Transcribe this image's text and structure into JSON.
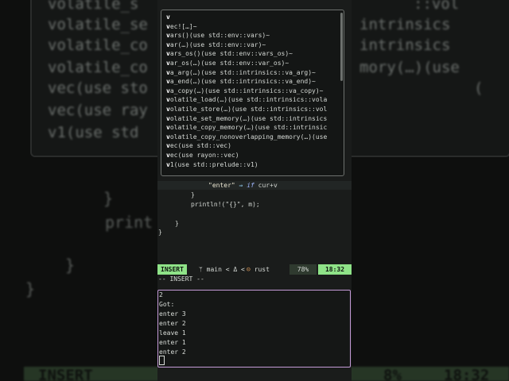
{
  "editor": {
    "code": {
      "match_arm": {
        "str": "\"enter\"",
        "arrow": "⇒",
        "kw": "if",
        "rest": "cur+v"
      },
      "close_brace_inner": "}",
      "println": "println!(\"{}\", m);",
      "close_brace_mid": "}",
      "close_brace_outer": "}"
    },
    "completion": {
      "items": [
        {
          "match": "v",
          "rest": ""
        },
        {
          "match": "v",
          "rest": "ec![…]~"
        },
        {
          "match": "v",
          "rest": "ars()(use std::env::vars)~"
        },
        {
          "match": "v",
          "rest": "ar(…)(use std::env::var)~"
        },
        {
          "match": "v",
          "rest": "ars_os()(use std::env::vars_os)~"
        },
        {
          "match": "v",
          "rest": "ar_os(…)(use std::env::var_os)~"
        },
        {
          "match": "v",
          "rest": "a_arg(…)(use std::intrinsics::va_arg)~"
        },
        {
          "match": "v",
          "rest": "a_end(…)(use std::intrinsics::va_end)~"
        },
        {
          "match": "v",
          "rest": "a_copy(…)(use std::intrinsics::va_copy)~"
        },
        {
          "match": "v",
          "rest": "olatile_load(…)(use std::intrinsics::vola"
        },
        {
          "match": "v",
          "rest": "olatile_store(…)(use std::intrinsics::vol"
        },
        {
          "match": "v",
          "rest": "olatile_set_memory(…)(use std::intrinsics"
        },
        {
          "match": "v",
          "rest": "olatile_copy_memory(…)(use std::intrinsic"
        },
        {
          "match": "v",
          "rest": "olatile_copy_nonoverlapping_memory(…)(use"
        },
        {
          "match": "v",
          "rest": "ec(use std::vec)"
        },
        {
          "match": "v",
          "rest": "ec(use rayon::vec)"
        },
        {
          "match": "v",
          "rest": "1(use std::prelude::v1)"
        }
      ]
    }
  },
  "statusline": {
    "mode": "INSERT",
    "branch_icon": "git-branch-icon",
    "branch": "main",
    "separator": "< Δ <",
    "lang_icon": "rust-icon",
    "lang": "rust",
    "percent": "78%",
    "time": "18:32"
  },
  "message_line": "-- INSERT --",
  "terminal": {
    "lines": [
      "2",
      "Got:",
      "enter 3",
      "enter 2",
      "leave 1",
      "enter 1",
      "enter 2"
    ]
  },
  "background": {
    "lines": [
      "volatile_s",
      "volatile_se",
      "volatile_co",
      "volatile_co",
      "vec(use sto",
      "vec(use ray",
      "v1(use std"
    ],
    "right_lines": [
      "::vol",
      "intrinsics",
      "intrinsics",
      "mory(…)(use",
      "("
    ],
    "code": [
      "}",
      "print",
      "}",
      "}"
    ],
    "status_mode": "INSERT",
    "status_pct": "8%",
    "status_time": "18:32"
  },
  "colors": {
    "accent_green": "#8fe388",
    "terminal_border": "#c59bd8",
    "background": "#1a1c1b"
  }
}
